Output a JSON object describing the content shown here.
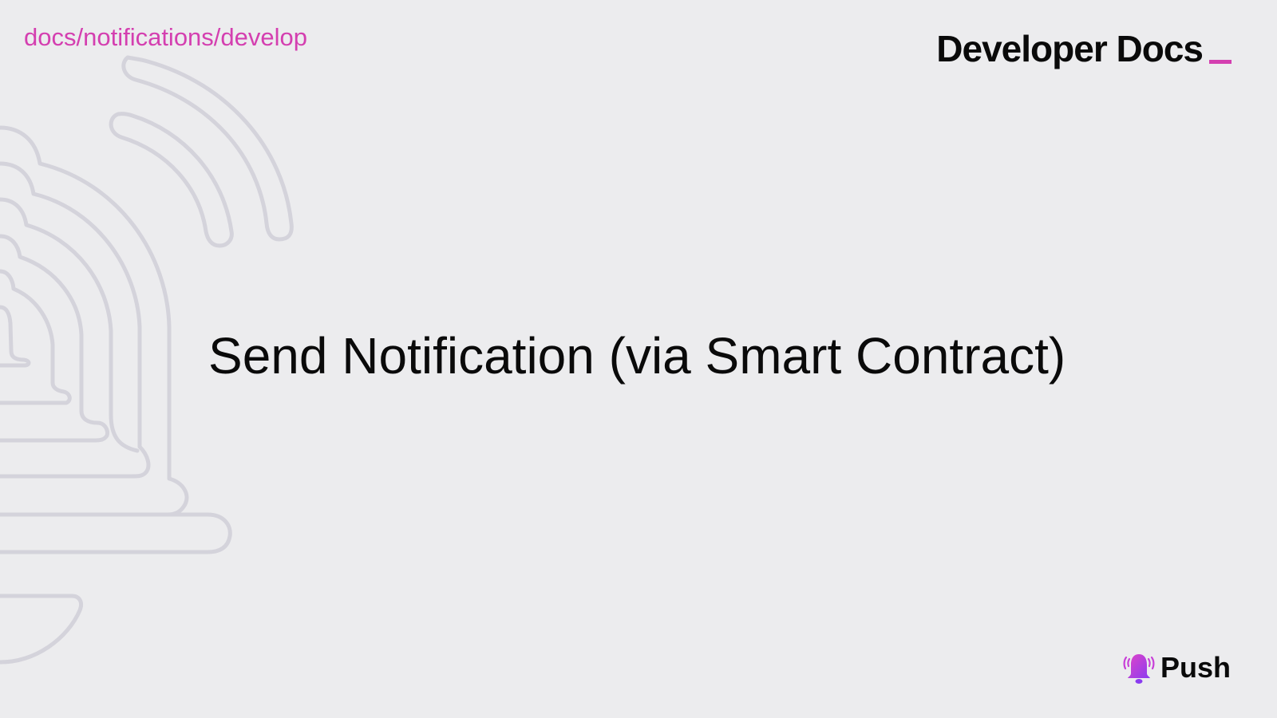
{
  "header": {
    "breadcrumb": "docs/notifications/develop",
    "brand_title": "Developer Docs"
  },
  "slide": {
    "title": "Send Notification (via Smart Contract)"
  },
  "logo": {
    "name": "Push",
    "icon": "bell-icon"
  },
  "colors": {
    "background": "#ECECEE",
    "accent": "#D43FB0",
    "text": "#0A0A0A",
    "decoration": "#D4D3DB"
  }
}
